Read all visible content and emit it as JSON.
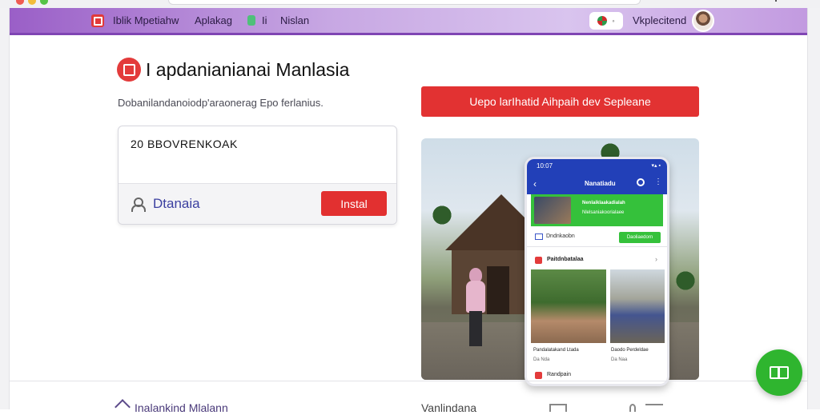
{
  "appbar": {
    "brand": "Iblik Mpetiahw",
    "nav_apps": "Aplakag",
    "nav_short": "Ii",
    "nav_third": "Nislan",
    "profile_name": "Vkplecitend"
  },
  "hero": {
    "title": "I apdanianianai Manlasia",
    "subtitle": "Dobanilandanoiodp'araonerag Epo ferlanius."
  },
  "cta_label": "Uepo larIhatid Aihpaih dev Sepleane",
  "card": {
    "input_value": "20 BBOVRENKOAK",
    "user_name": "Dtanaia",
    "install_label": "Instal"
  },
  "phone": {
    "time": "10:07",
    "status_icons": "▾▴ ▪",
    "nav_title": "Nanatiadu",
    "banner_title": "Nenlaiklaakadialah",
    "banner_text": "Nlelsaniakoorialaee",
    "row_label": "Dndnkaobn",
    "row_button": "Daoliaedorn",
    "section_title": "Paitdnbatalaa",
    "caption1_a": "Pandalatakand Ltada",
    "caption1_b": "Da Nda",
    "caption2_a": "Daodo Perdeldae",
    "caption2_b": "Da Naa",
    "footer_label": "Randpain"
  },
  "bottom": {
    "left_text": "Inalankind Mlalann",
    "right_text": "Vanlindana"
  },
  "colors": {
    "accent_red": "#e23232",
    "brand_purple": "#9a5fc7",
    "fab_green": "#2fb52f"
  }
}
